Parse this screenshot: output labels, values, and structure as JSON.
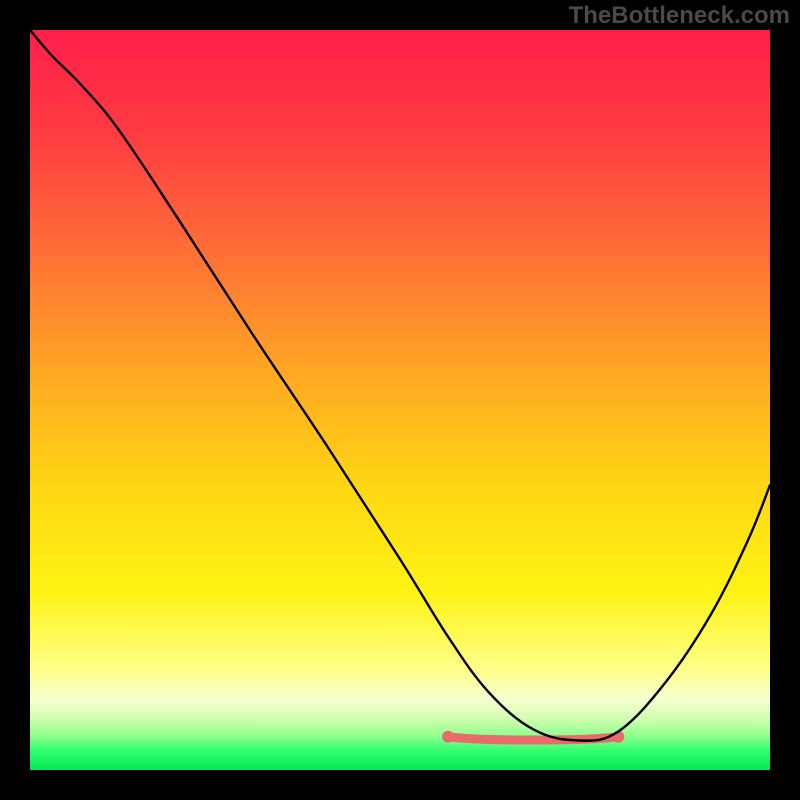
{
  "watermark": "TheBottleneck.com",
  "gradient": {
    "stops": [
      {
        "offset": 0.0,
        "color": "#ff1f4b"
      },
      {
        "offset": 0.14,
        "color": "#ff3b42"
      },
      {
        "offset": 0.3,
        "color": "#ff6f36"
      },
      {
        "offset": 0.46,
        "color": "#ffa623"
      },
      {
        "offset": 0.62,
        "color": "#ffd714"
      },
      {
        "offset": 0.76,
        "color": "#fff314"
      },
      {
        "offset": 0.865,
        "color": "#feff8a"
      },
      {
        "offset": 0.905,
        "color": "#f6ffd0"
      },
      {
        "offset": 0.93,
        "color": "#d2ffb0"
      },
      {
        "offset": 0.955,
        "color": "#8cff8c"
      },
      {
        "offset": 0.975,
        "color": "#2dff6e"
      },
      {
        "offset": 1.0,
        "color": "#06e555"
      }
    ]
  },
  "highlight": {
    "color": "#e96a6a",
    "width": 9,
    "dots_r": 6,
    "x0": 0.565,
    "x1": 0.795,
    "y": 0.955
  },
  "curve": {
    "color": "#000000",
    "width": 2.4
  },
  "chart_data": {
    "type": "line",
    "title": "",
    "xlabel": "",
    "ylabel": "",
    "xlim": [
      0,
      1
    ],
    "ylim": [
      0,
      1
    ],
    "note": "Axes unlabeled; x and y normalized 0–1. y is inverted (0 = top, 1 = bottom) to match screen space. Curve estimated from pixels.",
    "series": [
      {
        "name": "bottleneck-curve",
        "x": [
          0.0,
          0.03,
          0.07,
          0.12,
          0.2,
          0.3,
          0.4,
          0.5,
          0.565,
          0.62,
          0.68,
          0.74,
          0.795,
          0.86,
          0.92,
          0.97,
          1.0
        ],
        "y": [
          0.0,
          0.035,
          0.075,
          0.135,
          0.255,
          0.41,
          0.56,
          0.715,
          0.82,
          0.895,
          0.945,
          0.96,
          0.948,
          0.88,
          0.79,
          0.69,
          0.615
        ]
      },
      {
        "name": "highlight-flat-region",
        "x": [
          0.565,
          0.62,
          0.68,
          0.74,
          0.795
        ],
        "y": [
          0.955,
          0.955,
          0.955,
          0.955,
          0.955
        ]
      }
    ]
  }
}
